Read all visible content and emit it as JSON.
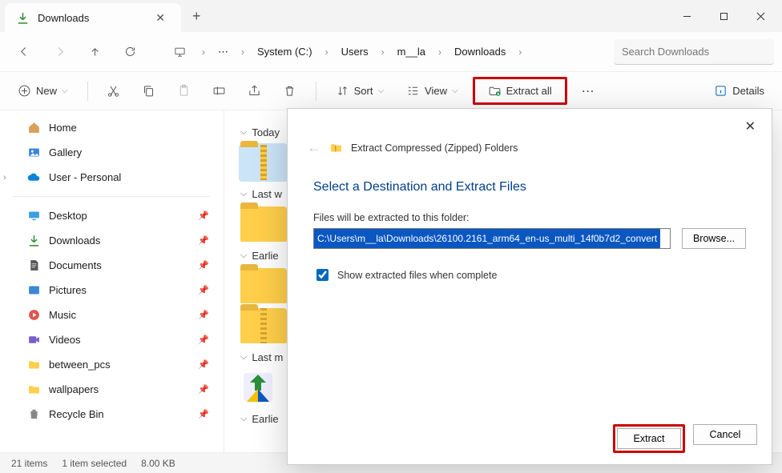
{
  "tab": {
    "title": "Downloads"
  },
  "breadcrumbs": {
    "b0": "System (C:)",
    "b1": "Users",
    "b2": "m__la",
    "b3": "Downloads"
  },
  "search": {
    "placeholder": "Search Downloads"
  },
  "toolbar": {
    "new": "New",
    "sort": "Sort",
    "view": "View",
    "extract_all": "Extract all",
    "details": "Details"
  },
  "sidebar": {
    "home": "Home",
    "gallery": "Gallery",
    "user_personal": "User - Personal",
    "desktop": "Desktop",
    "downloads": "Downloads",
    "documents": "Documents",
    "pictures": "Pictures",
    "music": "Music",
    "videos": "Videos",
    "between_pcs": "between_pcs",
    "wallpapers": "wallpapers",
    "recycle_bin": "Recycle Bin"
  },
  "groups": {
    "g0": "Today",
    "g1": "Last w",
    "g2": "Earlie",
    "g3": "Last m",
    "g4": "Earlie"
  },
  "status": {
    "items": "21 items",
    "selected": "1 item selected",
    "size": "8.00 KB"
  },
  "dialog": {
    "title_small": "Extract Compressed (Zipped) Folders",
    "heading": "Select a Destination and Extract Files",
    "label": "Files will be extracted to this folder:",
    "path": "C:\\Users\\m__la\\Downloads\\26100.2161_arm64_en-us_multi_14f0b7d2_convert",
    "browse": "Browse...",
    "show_extracted": "Show extracted files when complete",
    "extract": "Extract",
    "cancel": "Cancel"
  }
}
